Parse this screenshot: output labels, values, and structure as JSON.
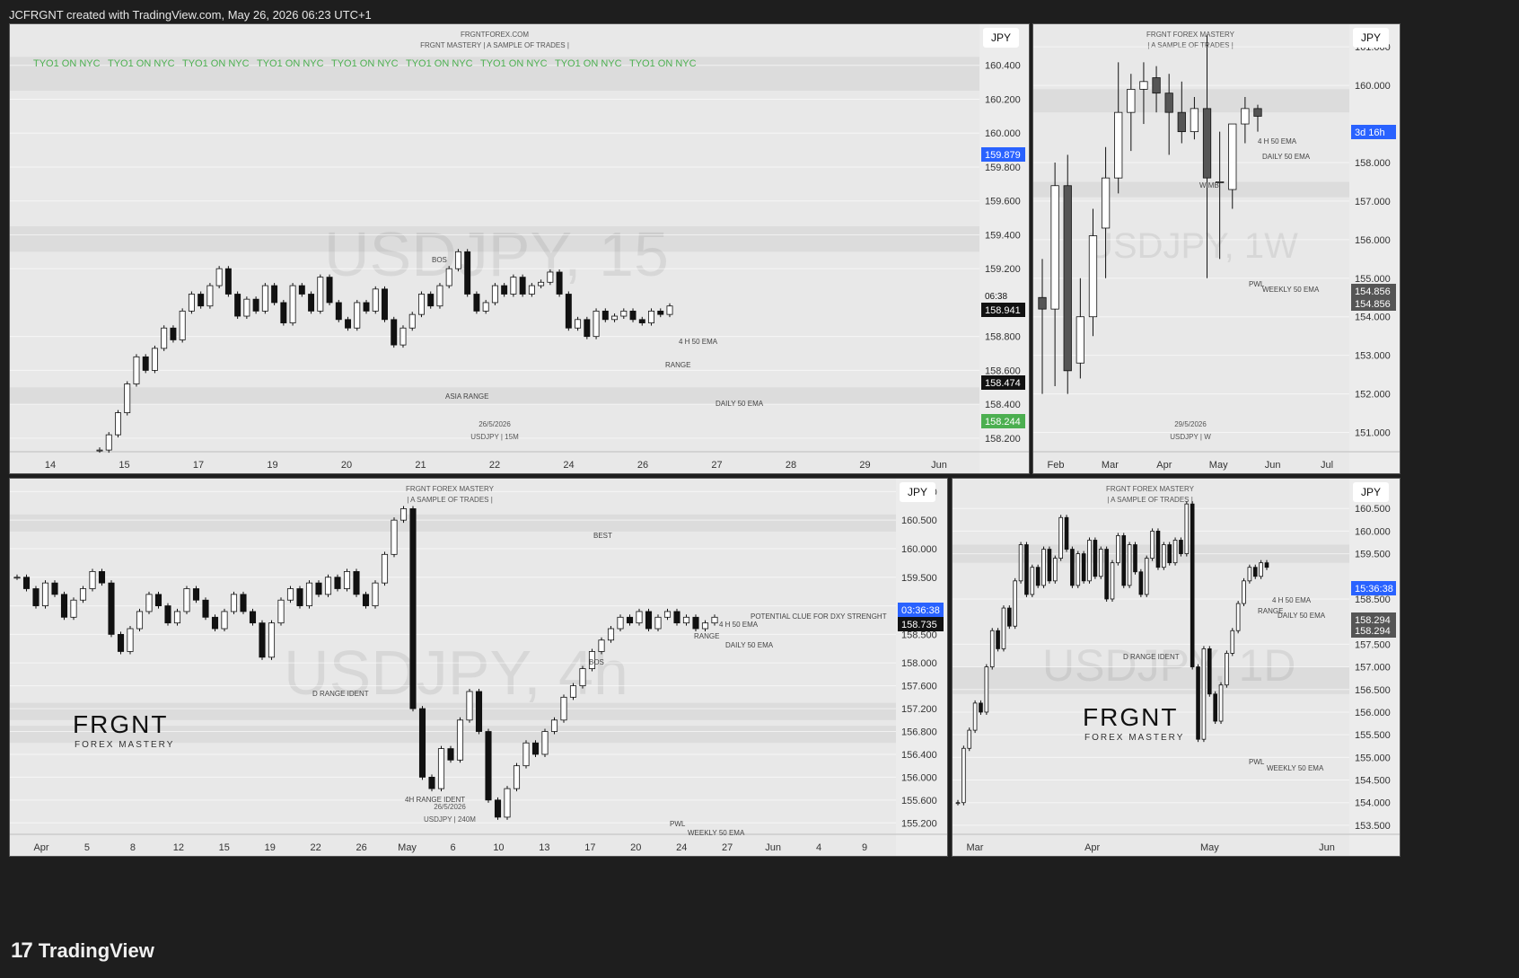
{
  "header": {
    "text": "JCFRGNT created with TradingView.com, May 26, 2026 06:23 UTC+1"
  },
  "footer": {
    "logo_text": "TradingView",
    "logo_icon": "tradingview-logo-icon"
  },
  "colors": {
    "bg": "#1e1e1e",
    "panel": "#e8e8e8",
    "blue": "#2962ff",
    "green": "#4caf50",
    "red": "#e53935",
    "candle": "#111111"
  },
  "chart_data": [
    {
      "type": "candlestick",
      "watermark": "USDJPY, 15",
      "currency": "JPY",
      "titles": [
        "FRGNTFOREX.COM",
        "FRGNT MASTERY  |  A SAMPLE OF TRADES |"
      ],
      "footer_date": "26/5/2026",
      "footer_symbol": "USDJPY | 15M",
      "session_text": "TYO1 ON NYC",
      "x_ticks": [
        "14",
        "15",
        "17",
        "19",
        "20",
        "21",
        "22",
        "24",
        "26",
        "27",
        "28",
        "29",
        "Jun"
      ],
      "y_ticks": [
        "160.400",
        "160.200",
        "160.000",
        "159.800",
        "159.600",
        "159.400",
        "159.200",
        "158.800",
        "158.600",
        "158.400",
        "158.200"
      ],
      "ylim": [
        158.12,
        160.6
      ],
      "price_badges": [
        {
          "value": "159.879",
          "color": "#2962ff"
        },
        {
          "value": "158.941",
          "color": "#111111",
          "time": "06:38"
        },
        {
          "value": "158.474",
          "color": "#111111"
        },
        {
          "value": "158.244",
          "color": "#4caf50"
        }
      ],
      "labels": [
        "BOS",
        "4 H 50 EMA",
        "RANGE",
        "ASIA RANGE",
        "DAILY 50 EMA"
      ],
      "series_close": [
        158.13,
        158.22,
        158.35,
        158.52,
        158.68,
        158.6,
        158.73,
        158.85,
        158.78,
        158.95,
        159.05,
        158.98,
        159.1,
        159.2,
        159.05,
        158.92,
        159.02,
        158.95,
        159.1,
        159.0,
        158.88,
        159.1,
        159.05,
        158.95,
        159.15,
        159.0,
        158.9,
        158.85,
        159.0,
        158.95,
        159.08,
        158.9,
        158.75,
        158.85,
        158.93,
        159.05,
        158.98,
        159.1,
        159.2,
        159.3,
        159.05,
        158.95,
        159.0,
        159.1,
        159.05,
        159.15,
        159.05,
        159.1,
        159.12,
        159.18,
        159.05,
        158.85,
        158.9,
        158.8,
        158.95,
        158.9,
        158.92,
        158.95,
        158.9,
        158.88,
        158.95,
        158.93,
        158.98
      ]
    },
    {
      "type": "candlestick",
      "watermark": "USDJPY, 1W",
      "currency": "JPY",
      "titles": [
        "FRGNT FOREX MASTERY",
        "|  A SAMPLE OF TRADES |"
      ],
      "footer_date": "29/5/2026",
      "footer_symbol": "USDJPY | W",
      "x_ticks": [
        "Feb",
        "Mar",
        "Apr",
        "May",
        "Jun",
        "Jul"
      ],
      "y_ticks": [
        "161.000",
        "160.000",
        "158.000",
        "157.000",
        "156.000",
        "155.000",
        "154.000",
        "153.000",
        "152.000",
        "151.000"
      ],
      "ylim": [
        150.5,
        161.4
      ],
      "price_badges": [
        {
          "value": "3d 16h",
          "color": "#2962ff"
        },
        {
          "value": "154.856",
          "color": "#555555"
        },
        {
          "value": "154.856",
          "color": "#555555"
        }
      ],
      "labels": [
        "4 H 50 EMA",
        "DAILY 50 EMA",
        "WIMB",
        "PWL",
        "WEEKLY 50 EMA"
      ],
      "ohlc": [
        [
          154.5,
          155.5,
          152.0,
          154.2
        ],
        [
          154.2,
          158.0,
          152.2,
          157.4
        ],
        [
          157.4,
          158.2,
          152.0,
          152.6
        ],
        [
          152.8,
          155.0,
          152.4,
          154.0
        ],
        [
          154.0,
          156.8,
          153.5,
          156.1
        ],
        [
          156.3,
          158.4,
          155.0,
          157.6
        ],
        [
          157.6,
          160.6,
          157.2,
          159.3
        ],
        [
          159.3,
          160.3,
          158.3,
          159.9
        ],
        [
          159.9,
          160.6,
          159.0,
          160.1
        ],
        [
          160.2,
          160.5,
          159.3,
          159.8
        ],
        [
          159.8,
          160.3,
          158.2,
          159.3
        ],
        [
          159.3,
          160.1,
          158.5,
          158.8
        ],
        [
          158.8,
          159.7,
          158.6,
          159.4
        ],
        [
          159.4,
          161.3,
          155.0,
          157.6
        ],
        [
          157.5,
          158.8,
          155.5,
          157.5
        ],
        [
          157.3,
          159.0,
          156.8,
          159.0
        ],
        [
          159.0,
          159.7,
          158.5,
          159.4
        ],
        [
          159.4,
          159.5,
          158.8,
          159.2
        ]
      ]
    },
    {
      "type": "candlestick",
      "watermark": "USDJPY, 4h",
      "currency": "JPY",
      "titles": [
        "FRGNT FOREX MASTERY",
        "|  A SAMPLE OF TRADES |"
      ],
      "footer_date": "26/5/2026",
      "footer_symbol": "USDJPY | 240M",
      "brand": [
        "FRGNT",
        "FOREX MASTERY"
      ],
      "x_ticks": [
        "Apr",
        "5",
        "8",
        "12",
        "15",
        "19",
        "22",
        "26",
        "May",
        "6",
        "10",
        "13",
        "17",
        "20",
        "24",
        "27",
        "Jun",
        "4",
        "9"
      ],
      "y_ticks": [
        "161.000",
        "160.500",
        "160.000",
        "159.500",
        "159.000",
        "158.500",
        "158.000",
        "157.600",
        "157.200",
        "156.800",
        "156.400",
        "156.000",
        "155.600",
        "155.200"
      ],
      "ylim": [
        155.0,
        161.1
      ],
      "price_badges": [
        {
          "value": "03:36:38",
          "color": "#2962ff"
        },
        {
          "value": "158.735",
          "color": "#111111"
        }
      ],
      "labels": [
        "BEST",
        "POTENTIAL CLUE FOR DXY STRENGHT",
        "4 H 50 EMA",
        "RANGE",
        "DAILY 50 EMA",
        "D RANGE IDENT",
        "4H RANGE IDENT",
        "BOS",
        "PWL",
        "WEEKLY 50 EMA"
      ],
      "series_close": [
        159.5,
        159.3,
        159.0,
        159.4,
        159.2,
        158.8,
        159.1,
        159.3,
        159.6,
        159.4,
        158.5,
        158.2,
        158.6,
        158.9,
        159.2,
        159.0,
        158.7,
        158.9,
        159.3,
        159.1,
        158.8,
        158.6,
        158.9,
        159.2,
        158.9,
        158.7,
        158.1,
        158.7,
        159.1,
        159.3,
        159.0,
        159.4,
        159.2,
        159.5,
        159.3,
        159.6,
        159.2,
        159.0,
        159.4,
        159.9,
        160.5,
        160.7,
        157.2,
        156.0,
        155.8,
        156.5,
        156.3,
        157.0,
        157.5,
        156.8,
        155.6,
        155.3,
        155.8,
        156.2,
        156.6,
        156.4,
        156.8,
        157.0,
        157.4,
        157.6,
        157.9,
        158.2,
        158.4,
        158.6,
        158.8,
        158.7,
        158.9,
        158.6,
        158.8,
        158.9,
        158.7,
        158.8,
        158.6,
        158.7,
        158.8
      ]
    },
    {
      "type": "candlestick",
      "watermark": "USDJPY, 1D",
      "currency": "JPY",
      "titles": [
        "FRGNT FOREX MASTERY",
        "|  A SAMPLE OF TRADES |"
      ],
      "brand": [
        "FRGNT",
        "FOREX MASTERY"
      ],
      "x_ticks": [
        "Mar",
        "Apr",
        "May",
        "Jun"
      ],
      "y_ticks": [
        "160.500",
        "160.000",
        "159.500",
        "158.500",
        "157.500",
        "157.000",
        "156.500",
        "156.000",
        "155.500",
        "155.000",
        "154.500",
        "154.000",
        "153.500"
      ],
      "ylim": [
        153.3,
        161.0
      ],
      "price_badges": [
        {
          "value": "15:36:38",
          "color": "#2962ff"
        },
        {
          "value": "158.294",
          "color": "#555555"
        },
        {
          "value": "158.294",
          "color": "#555555"
        }
      ],
      "labels": [
        "D RANGE IDENT",
        "RANGE",
        "4 H 50 EMA",
        "DAILY 50 EMA",
        "PWL",
        "WEEKLY 50 EMA"
      ],
      "series_close": [
        154.0,
        155.2,
        155.6,
        156.2,
        156.0,
        157.0,
        157.8,
        157.4,
        158.3,
        157.9,
        158.9,
        159.7,
        158.6,
        159.2,
        158.8,
        159.6,
        158.9,
        159.4,
        160.3,
        159.6,
        158.8,
        159.5,
        158.9,
        159.8,
        159.0,
        159.6,
        158.5,
        159.3,
        159.9,
        158.8,
        159.7,
        159.1,
        158.6,
        159.4,
        160.0,
        159.2,
        159.7,
        159.3,
        159.8,
        159.5,
        160.6,
        157.0,
        155.4,
        157.4,
        156.4,
        155.8,
        156.6,
        157.3,
        157.8,
        158.4,
        158.9,
        159.2,
        159.0,
        159.3,
        159.2
      ]
    }
  ]
}
